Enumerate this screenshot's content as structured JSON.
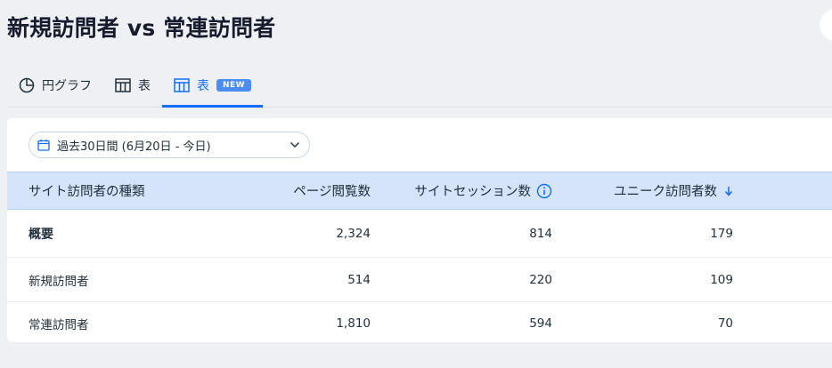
{
  "page": {
    "title": "新規訪問者 vs 常連訪問者"
  },
  "tabs": [
    {
      "label": "円グラフ",
      "icon": "pie-chart-icon",
      "active": false
    },
    {
      "label": "表",
      "icon": "table-icon",
      "active": false
    },
    {
      "label": "表",
      "icon": "table-icon",
      "active": true,
      "badge": "NEW"
    }
  ],
  "date_filter": {
    "label": "過去30日間 (6月20日 - 今日)",
    "icon": "calendar-icon"
  },
  "table": {
    "columns": [
      "サイト訪問者の種類",
      "ページ閲覧数",
      "サイトセッション数",
      "ユニーク訪問者数"
    ],
    "sort_column": "ユニーク訪問者数",
    "sort_direction": "descending",
    "rows": [
      {
        "type": "概要",
        "page_views": "2,324",
        "sessions": "814",
        "unique_visitors": "179"
      },
      {
        "type": "新規訪問者",
        "page_views": "514",
        "sessions": "220",
        "unique_visitors": "109"
      },
      {
        "type": "常連訪問者",
        "page_views": "1,810",
        "sessions": "594",
        "unique_visitors": "70"
      }
    ]
  },
  "colors": {
    "accent": "#116dff",
    "header_bg": "#d5e4fb",
    "page_bg": "#eef0f4"
  }
}
